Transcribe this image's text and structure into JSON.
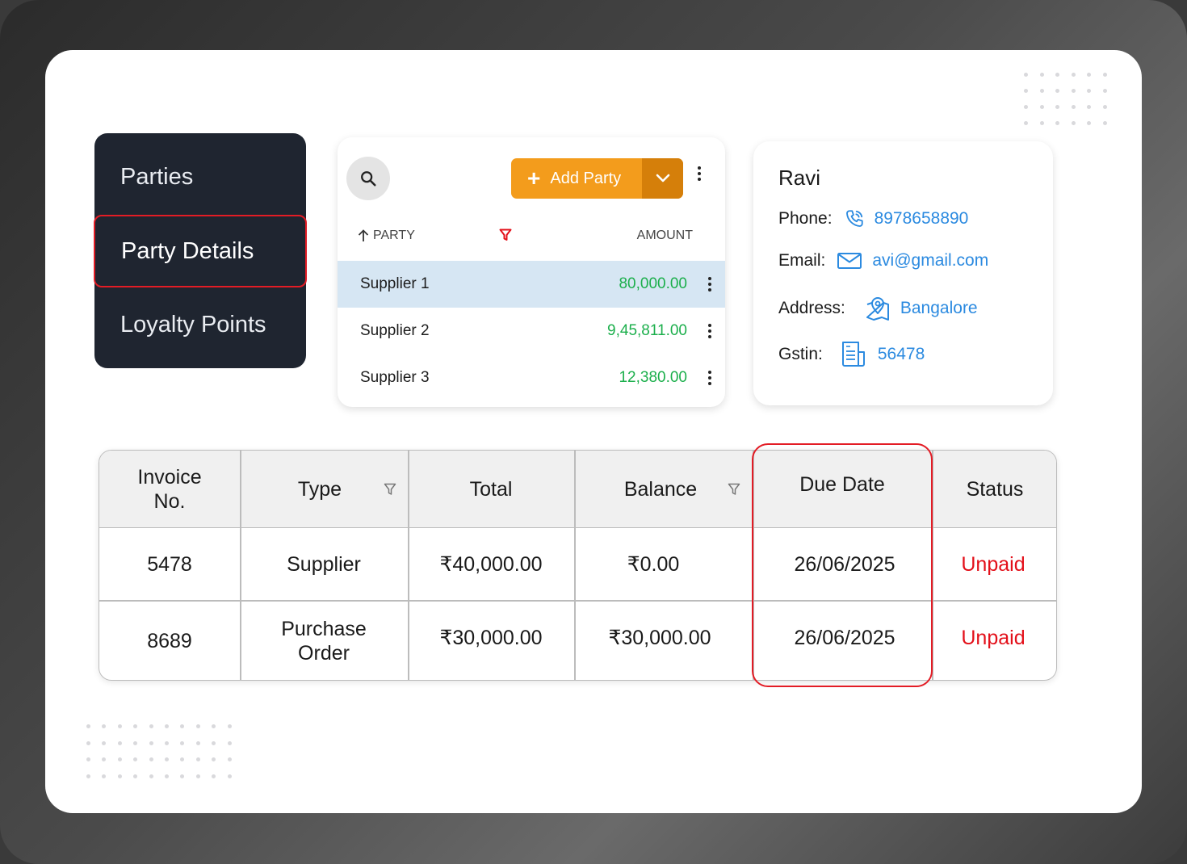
{
  "sidebar": {
    "items": [
      {
        "label": "Parties"
      },
      {
        "label": "Party Details"
      },
      {
        "label": "Loyalty Points"
      }
    ]
  },
  "party_list": {
    "add_button_label": "Add Party",
    "columns": {
      "party": "PARTY",
      "amount": "AMOUNT"
    },
    "rows": [
      {
        "name": "Supplier 1",
        "amount": "80,000.00",
        "selected": true
      },
      {
        "name": "Supplier 2",
        "amount": "9,45,811.00",
        "selected": false
      },
      {
        "name": "Supplier 3",
        "amount": "12,380.00",
        "selected": false
      }
    ],
    "colors": {
      "accent": "#f39c1c",
      "amount": "#1caf4c",
      "selected_row": "#d6e6f3"
    }
  },
  "contact": {
    "name": "Ravi",
    "phone_label": "Phone:",
    "phone": "8978658890",
    "email_label": "Email:",
    "email": "avi@gmail.com",
    "address_label": "Address:",
    "address": "Bangalore",
    "gstin_label": "Gstin:",
    "gstin": "56478",
    "link_color": "#2b8ae0"
  },
  "invoice_table": {
    "headers": {
      "invoice_no_line1": "Invoice",
      "invoice_no_line2": "No.",
      "type": "Type",
      "total": "Total",
      "balance": "Balance",
      "due_date": "Due Date",
      "status": "Status"
    },
    "rows": [
      {
        "invoice_no": "5478",
        "type_line1": "Supplier",
        "type_line2": "",
        "total": "₹40,000.00",
        "balance": "₹0.00",
        "due_date": "26/06/2025",
        "status": "Unpaid"
      },
      {
        "invoice_no": "8689",
        "type_line1": "Purchase",
        "type_line2": "Order",
        "total": "₹30,000.00",
        "balance": "₹30,000.00",
        "due_date": "26/06/2025",
        "status": "Unpaid"
      }
    ],
    "status_color": "#e3101a",
    "highlight_color": "#e31c25"
  }
}
